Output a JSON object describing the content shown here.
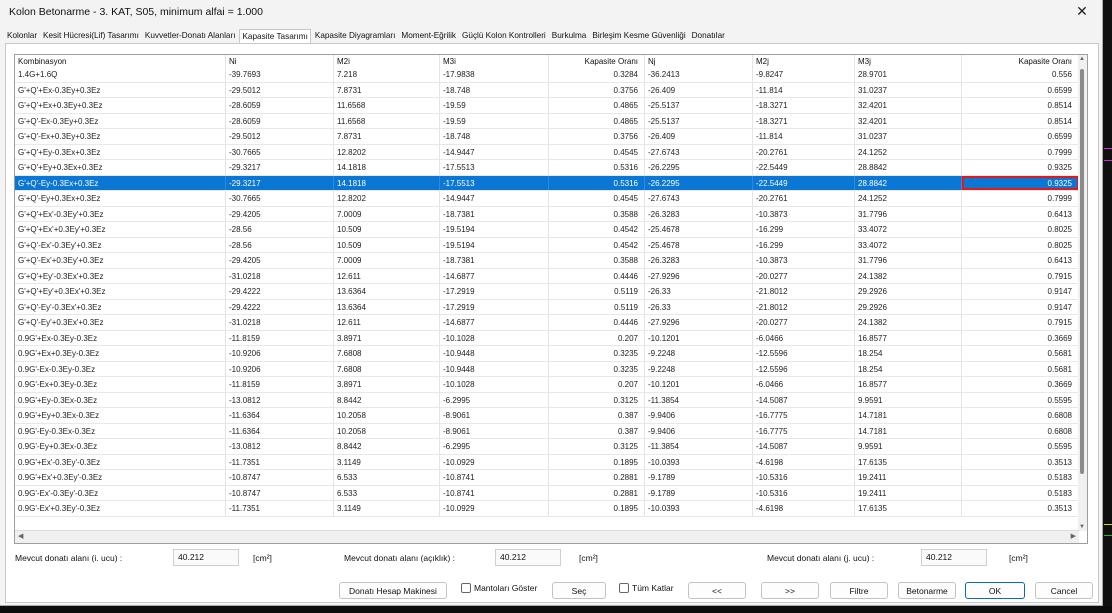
{
  "window": {
    "title": "Kolon Betonarme - 3. KAT, S05, minimum alfai = 1.000"
  },
  "tabs": [
    {
      "label": "Kolonlar",
      "active": false
    },
    {
      "label": "Kesit Hücresi(Lif) Tasarımı",
      "active": false
    },
    {
      "label": "Kuvvetler-Donatı Alanları",
      "active": false
    },
    {
      "label": "Kapasite Tasarımı",
      "active": true
    },
    {
      "label": "Kapasite Diyagramları",
      "active": false
    },
    {
      "label": "Moment-Eğrilik",
      "active": false
    },
    {
      "label": "Güçlü Kolon Kontrolleri",
      "active": false
    },
    {
      "label": "Burkulma",
      "active": false
    },
    {
      "label": "Birleşim Kesme Güvenliği",
      "active": false
    },
    {
      "label": "Donatılar",
      "active": false
    }
  ],
  "table": {
    "columns": [
      "Kombinasyon",
      "Ni",
      "M2i",
      "M3i",
      "Kapasite Oranı",
      "Nj",
      "M2j",
      "M3j",
      "Kapasite Oranı"
    ],
    "selected_index": 7,
    "rows": [
      [
        "1.4G+1.6Q",
        "-39.7693",
        "7.218",
        "-17.9838",
        "0.3284",
        "-36.2413",
        "-9.8247",
        "28.9701",
        "0.556"
      ],
      [
        "G'+Q'+Ex-0.3Ey+0.3Ez",
        "-29.5012",
        "7.8731",
        "-18.748",
        "0.3756",
        "-26.409",
        "-11.814",
        "31.0237",
        "0.6599"
      ],
      [
        "G'+Q'+Ex+0.3Ey+0.3Ez",
        "-28.6059",
        "11.6568",
        "-19.59",
        "0.4865",
        "-25.5137",
        "-18.3271",
        "32.4201",
        "0.8514"
      ],
      [
        "G'+Q'-Ex-0.3Ey+0.3Ez",
        "-28.6059",
        "11.6568",
        "-19.59",
        "0.4865",
        "-25.5137",
        "-18.3271",
        "32.4201",
        "0.8514"
      ],
      [
        "G'+Q'-Ex+0.3Ey+0.3Ez",
        "-29.5012",
        "7.8731",
        "-18.748",
        "0.3756",
        "-26.409",
        "-11.814",
        "31.0237",
        "0.6599"
      ],
      [
        "G'+Q'+Ey-0.3Ex+0.3Ez",
        "-30.7665",
        "12.8202",
        "-14.9447",
        "0.4545",
        "-27.6743",
        "-20.2761",
        "24.1252",
        "0.7999"
      ],
      [
        "G'+Q'+Ey+0.3Ex+0.3Ez",
        "-29.3217",
        "14.1818",
        "-17.5513",
        "0.5316",
        "-26.2295",
        "-22.5449",
        "28.8842",
        "0.9325"
      ],
      [
        "G'+Q'-Ey-0.3Ex+0.3Ez",
        "-29.3217",
        "14.1818",
        "-17.5513",
        "0.5316",
        "-26.2295",
        "-22.5449",
        "28.8842",
        "0.9325"
      ],
      [
        "G'+Q'-Ey+0.3Ex+0.3Ez",
        "-30.7665",
        "12.8202",
        "-14.9447",
        "0.4545",
        "-27.6743",
        "-20.2761",
        "24.1252",
        "0.7999"
      ],
      [
        "G'+Q'+Ex'-0.3Ey'+0.3Ez",
        "-29.4205",
        "7.0009",
        "-18.7381",
        "0.3588",
        "-26.3283",
        "-10.3873",
        "31.7796",
        "0.6413"
      ],
      [
        "G'+Q'+Ex'+0.3Ey'+0.3Ez",
        "-28.56",
        "10.509",
        "-19.5194",
        "0.4542",
        "-25.4678",
        "-16.299",
        "33.4072",
        "0.8025"
      ],
      [
        "G'+Q'-Ex'-0.3Ey'+0.3Ez",
        "-28.56",
        "10.509",
        "-19.5194",
        "0.4542",
        "-25.4678",
        "-16.299",
        "33.4072",
        "0.8025"
      ],
      [
        "G'+Q'-Ex'+0.3Ey'+0.3Ez",
        "-29.4205",
        "7.0009",
        "-18.7381",
        "0.3588",
        "-26.3283",
        "-10.3873",
        "31.7796",
        "0.6413"
      ],
      [
        "G'+Q'+Ey'-0.3Ex'+0.3Ez",
        "-31.0218",
        "12.611",
        "-14.6877",
        "0.4446",
        "-27.9296",
        "-20.0277",
        "24.1382",
        "0.7915"
      ],
      [
        "G'+Q'+Ey'+0.3Ex'+0.3Ez",
        "-29.4222",
        "13.6364",
        "-17.2919",
        "0.5119",
        "-26.33",
        "-21.8012",
        "29.2926",
        "0.9147"
      ],
      [
        "G'+Q'-Ey'-0.3Ex'+0.3Ez",
        "-29.4222",
        "13.6364",
        "-17.2919",
        "0.5119",
        "-26.33",
        "-21.8012",
        "29.2926",
        "0.9147"
      ],
      [
        "G'+Q'-Ey'+0.3Ex'+0.3Ez",
        "-31.0218",
        "12.611",
        "-14.6877",
        "0.4446",
        "-27.9296",
        "-20.0277",
        "24.1382",
        "0.7915"
      ],
      [
        "0.9G'+Ex-0.3Ey-0.3Ez",
        "-11.8159",
        "3.8971",
        "-10.1028",
        "0.207",
        "-10.1201",
        "-6.0466",
        "16.8577",
        "0.3669"
      ],
      [
        "0.9G'+Ex+0.3Ey-0.3Ez",
        "-10.9206",
        "7.6808",
        "-10.9448",
        "0.3235",
        "-9.2248",
        "-12.5596",
        "18.254",
        "0.5681"
      ],
      [
        "0.9G'-Ex-0.3Ey-0.3Ez",
        "-10.9206",
        "7.6808",
        "-10.9448",
        "0.3235",
        "-9.2248",
        "-12.5596",
        "18.254",
        "0.5681"
      ],
      [
        "0.9G'-Ex+0.3Ey-0.3Ez",
        "-11.8159",
        "3.8971",
        "-10.1028",
        "0.207",
        "-10.1201",
        "-6.0466",
        "16.8577",
        "0.3669"
      ],
      [
        "0.9G'+Ey-0.3Ex-0.3Ez",
        "-13.0812",
        "8.8442",
        "-6.2995",
        "0.3125",
        "-11.3854",
        "-14.5087",
        "9.9591",
        "0.5595"
      ],
      [
        "0.9G'+Ey+0.3Ex-0.3Ez",
        "-11.6364",
        "10.2058",
        "-8.9061",
        "0.387",
        "-9.9406",
        "-16.7775",
        "14.7181",
        "0.6808"
      ],
      [
        "0.9G'-Ey-0.3Ex-0.3Ez",
        "-11.6364",
        "10.2058",
        "-8.9061",
        "0.387",
        "-9.9406",
        "-16.7775",
        "14.7181",
        "0.6808"
      ],
      [
        "0.9G'-Ey+0.3Ex-0.3Ez",
        "-13.0812",
        "8.8442",
        "-6.2995",
        "0.3125",
        "-11.3854",
        "-14.5087",
        "9.9591",
        "0.5595"
      ],
      [
        "0.9G'+Ex'-0.3Ey'-0.3Ez",
        "-11.7351",
        "3.1149",
        "-10.0929",
        "0.1895",
        "-10.0393",
        "-4.6198",
        "17.6135",
        "0.3513"
      ],
      [
        "0.9G'+Ex'+0.3Ey'-0.3Ez",
        "-10.8747",
        "6.533",
        "-10.8741",
        "0.2881",
        "-9.1789",
        "-10.5316",
        "19.2411",
        "0.5183"
      ],
      [
        "0.9G'-Ex'-0.3Ey'-0.3Ez",
        "-10.8747",
        "6.533",
        "-10.8741",
        "0.2881",
        "-9.1789",
        "-10.5316",
        "19.2411",
        "0.5183"
      ],
      [
        "0.9G'-Ex'+0.3Ey'-0.3Ez",
        "-11.7351",
        "3.1149",
        "-10.0929",
        "0.1895",
        "-10.0393",
        "-4.6198",
        "17.6135",
        "0.3513"
      ]
    ]
  },
  "fields": {
    "i_label": "Mevcut donatı alanı (i. ucu) :",
    "i_value": "40.212",
    "mid_label": "Mevcut donatı alanı (açıklık) :",
    "mid_value": "40.212",
    "j_label": "Mevcut donatı alanı (j. ucu) :",
    "j_value": "40.212",
    "unit": "[cm²]"
  },
  "buttons": {
    "calc": "Donatı Hesap Makinesi",
    "mantolar": "Mantoları Göster",
    "sec": "Seç",
    "tum_katlar": "Tüm Katlar",
    "prev": "<<",
    "next": ">>",
    "filtre": "Filtre",
    "betonarme": "Betonarme",
    "ok": "OK",
    "cancel": "Cancel"
  },
  "icons": {
    "close": "close-icon",
    "scroll_left": "arrow-left-icon",
    "scroll_right": "arrow-right-icon"
  }
}
